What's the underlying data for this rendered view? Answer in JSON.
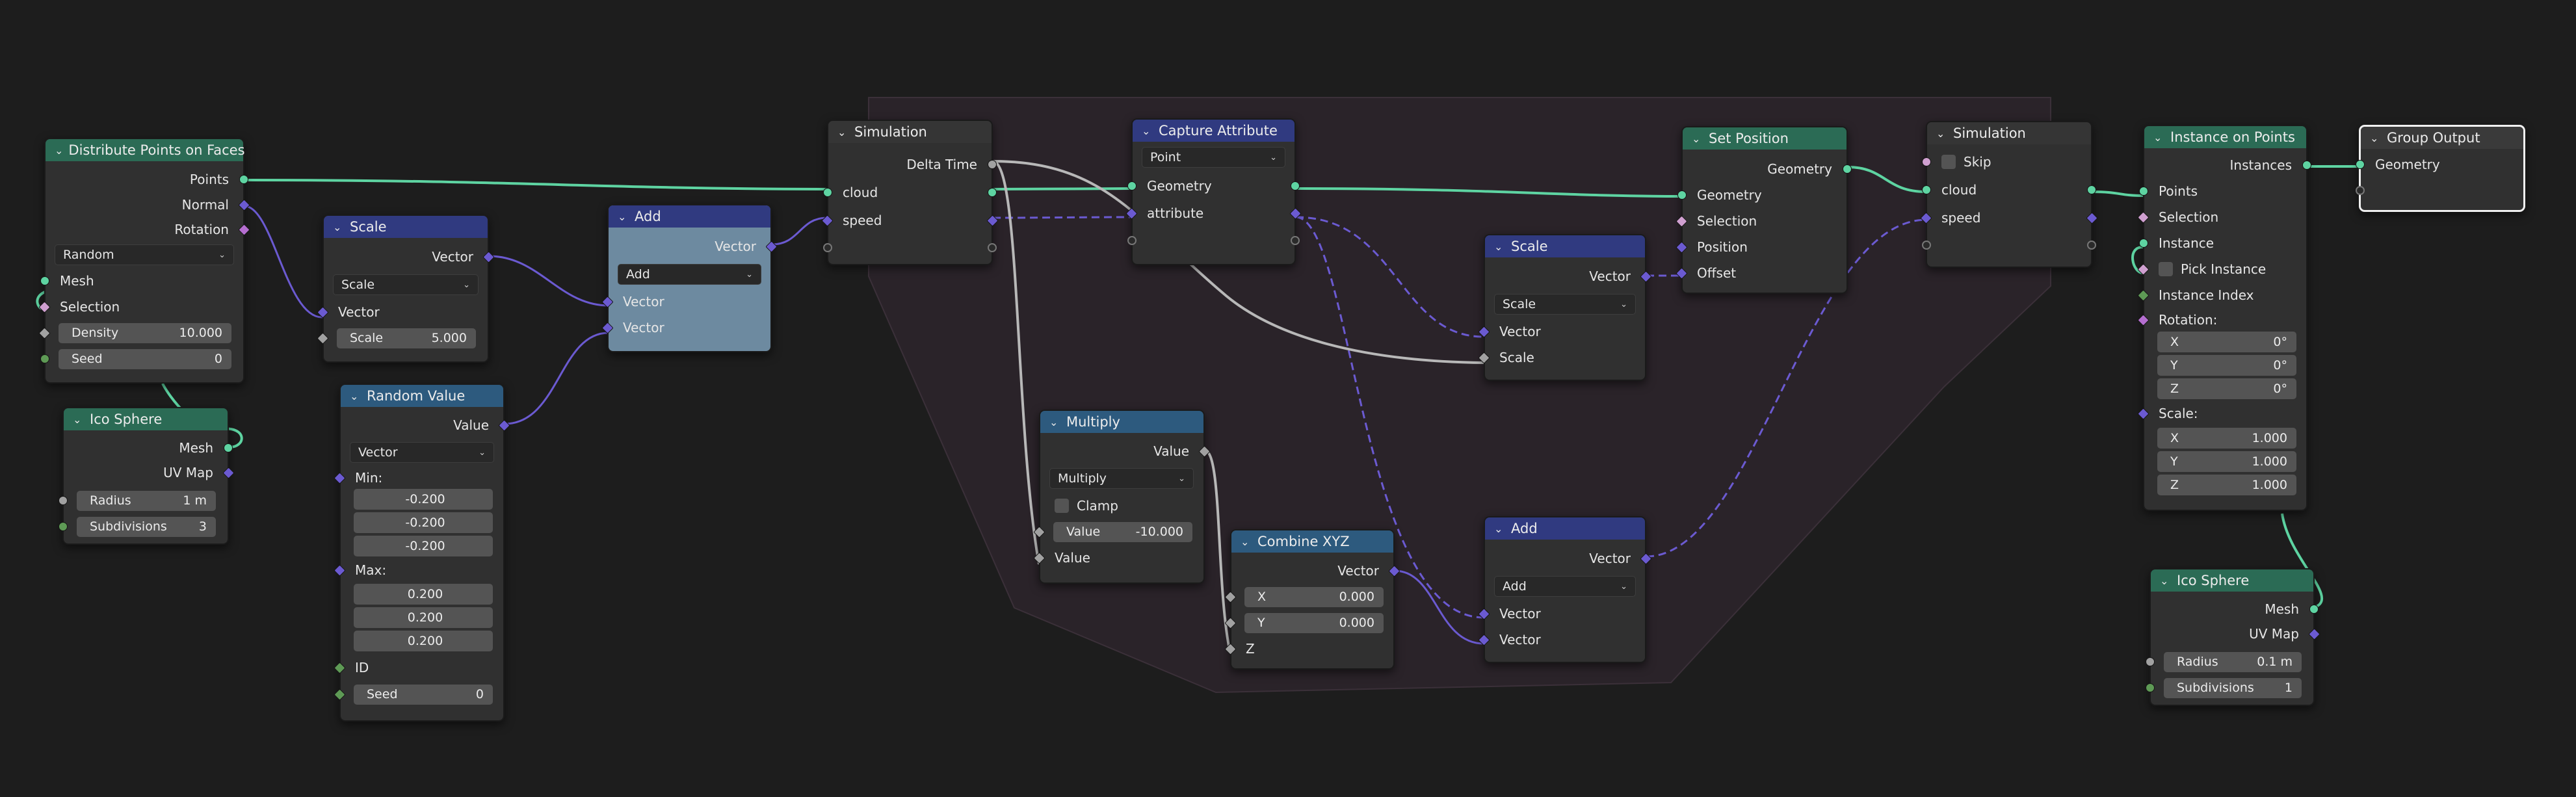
{
  "colors": {
    "background": "#1d1d1d",
    "node": "#303030",
    "geometry_header": "#2b6b55",
    "vector_header": "#303a80",
    "converter_header": "#2d5a7e",
    "geometry_socket": "#5ed4a2",
    "vector_socket": "#6b5ad1",
    "float_socket": "#a1a1a1",
    "int_socket": "#5e9a55",
    "rotation_socket": "#b56ed0",
    "frame": "#2a2329"
  },
  "nodes": {
    "distribute": {
      "title": "Distribute Points on Faces",
      "out_points": "Points",
      "out_normal": "Normal",
      "out_rotation": "Rotation",
      "mode": "Random",
      "in_mesh": "Mesh",
      "in_selection": "Selection",
      "density_label": "Density",
      "density_value": "10.000",
      "seed_label": "Seed",
      "seed_value": "0"
    },
    "ico1": {
      "title": "Ico Sphere",
      "out_mesh": "Mesh",
      "out_uv": "UV Map",
      "radius_label": "Radius",
      "radius_value": "1 m",
      "subdiv_label": "Subdivisions",
      "subdiv_value": "3"
    },
    "scale1": {
      "title": "Scale",
      "out_vector": "Vector",
      "mode": "Scale",
      "in_vector": "Vector",
      "scale_label": "Scale",
      "scale_value": "5.000"
    },
    "random": {
      "title": "Random Value",
      "out_value": "Value",
      "type": "Vector",
      "min_label": "Min:",
      "min": [
        "-0.200",
        "-0.200",
        "-0.200"
      ],
      "max_label": "Max:",
      "max": [
        "0.200",
        "0.200",
        "0.200"
      ],
      "id_label": "ID",
      "seed_label": "Seed",
      "seed_value": "0"
    },
    "add1": {
      "title": "Add",
      "out_vector": "Vector",
      "mode": "Add",
      "in_vector1": "Vector",
      "in_vector2": "Vector"
    },
    "sim_in": {
      "title": "Simulation",
      "out_delta": "Delta Time",
      "cloud": "cloud",
      "speed": "speed"
    },
    "capture": {
      "title": "Capture Attribute",
      "domain": "Point",
      "geometry": "Geometry",
      "attribute": "attribute"
    },
    "multiply": {
      "title": "Multiply",
      "out_value": "Value",
      "mode": "Multiply",
      "clamp": "Clamp",
      "value_label": "Value",
      "value_value": "-10.000",
      "in_value": "Value"
    },
    "combine": {
      "title": "Combine XYZ",
      "out_vector": "Vector",
      "x_label": "X",
      "x_value": "0.000",
      "y_label": "Y",
      "y_value": "0.000",
      "z_label": "Z"
    },
    "scale2": {
      "title": "Scale",
      "out_vector": "Vector",
      "mode": "Scale",
      "in_vector": "Vector",
      "in_scale": "Scale"
    },
    "add2": {
      "title": "Add",
      "out_vector": "Vector",
      "mode": "Add",
      "in_vector1": "Vector",
      "in_vector2": "Vector"
    },
    "setpos": {
      "title": "Set Position",
      "out_geometry": "Geometry",
      "in_geometry": "Geometry",
      "selection": "Selection",
      "position": "Position",
      "offset": "Offset"
    },
    "sim_out": {
      "title": "Simulation",
      "skip": "Skip",
      "cloud": "cloud",
      "speed": "speed"
    },
    "instance": {
      "title": "Instance on Points",
      "out_instances": "Instances",
      "points": "Points",
      "selection": "Selection",
      "instance": "Instance",
      "pick": "Pick Instance",
      "index": "Instance Index",
      "rotation_label": "Rotation:",
      "rot": [
        {
          "axis": "X",
          "value": "0°"
        },
        {
          "axis": "Y",
          "value": "0°"
        },
        {
          "axis": "Z",
          "value": "0°"
        }
      ],
      "scale_label": "Scale:",
      "scl": [
        {
          "axis": "X",
          "value": "1.000"
        },
        {
          "axis": "Y",
          "value": "1.000"
        },
        {
          "axis": "Z",
          "value": "1.000"
        }
      ]
    },
    "group_out": {
      "title": "Group Output",
      "geometry": "Geometry"
    },
    "ico2": {
      "title": "Ico Sphere",
      "out_mesh": "Mesh",
      "out_uv": "UV Map",
      "radius_label": "Radius",
      "radius_value": "0.1 m",
      "subdiv_label": "Subdivisions",
      "subdiv_value": "1"
    }
  }
}
